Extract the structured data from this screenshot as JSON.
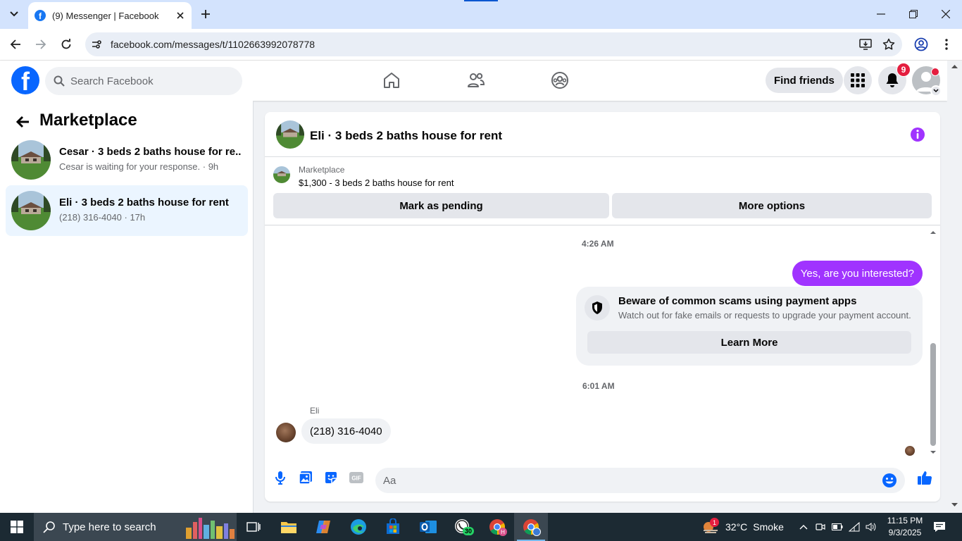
{
  "browser": {
    "tab_title": "(9) Messenger | Facebook",
    "url": "facebook.com/messages/t/1102663992078778"
  },
  "fb": {
    "logo_letter": "f",
    "search_placeholder": "Search Facebook",
    "find_friends": "Find friends",
    "notification_count": "9",
    "accent": "#0866ff"
  },
  "sidebar": {
    "title": "Marketplace",
    "conversations": [
      {
        "name": "Cesar · 3 beds 2 baths house for re...",
        "sub": "Cesar is waiting for your response. · 9h",
        "active": false
      },
      {
        "name": "Eli · 3 beds 2 baths house for rent",
        "sub": "(218) 316-4040 · 17h",
        "active": true
      }
    ]
  },
  "chat": {
    "title": "Eli · 3 beds 2 baths house for rent",
    "listing": {
      "label": "Marketplace",
      "price_title": "$1,300 - 3 beds 2 baths house for rent",
      "mark_pending": "Mark as pending",
      "more_options": "More options"
    },
    "messages": {
      "time1": "4:26 AM",
      "outgoing": "Yes, are you interested?",
      "scam_title": "Beware of common scams using payment apps",
      "scam_desc": "Watch out for fake emails or requests to upgrade your payment account.",
      "learn_more": "Learn More",
      "time2": "6:01 AM",
      "sender": "Eli",
      "incoming": "(218) 316-4040"
    },
    "composer_placeholder": "Aa",
    "bubble_color": "#a033ff"
  },
  "taskbar": {
    "search_placeholder": "Type here to search",
    "weather_temp": "32°C",
    "weather_desc": "Smoke",
    "weather_badge": "1",
    "time": "11:15 PM",
    "date": "9/3/2025",
    "whatsapp_badge": "30"
  }
}
